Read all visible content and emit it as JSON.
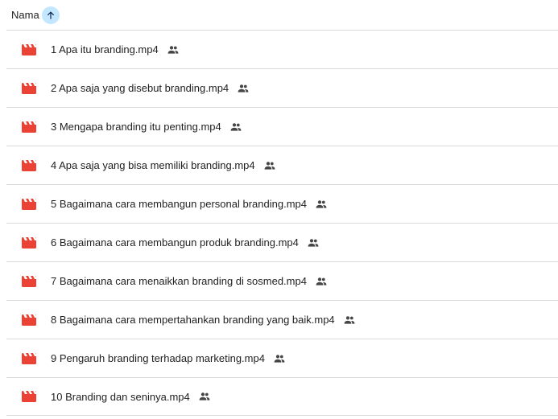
{
  "header": {
    "column_label": "Nama",
    "sort_icon": "arrow-up-icon",
    "sort_color": "#c2e7ff"
  },
  "files": [
    {
      "name": "1 Apa itu branding.mp4",
      "icon": "video-file-icon",
      "shared_icon": "people-icon"
    },
    {
      "name": "2 Apa saja yang disebut branding.mp4",
      "icon": "video-file-icon",
      "shared_icon": "people-icon"
    },
    {
      "name": "3 Mengapa branding itu penting.mp4",
      "icon": "video-file-icon",
      "shared_icon": "people-icon"
    },
    {
      "name": "4 Apa saja yang bisa memiliki branding.mp4",
      "icon": "video-file-icon",
      "shared_icon": "people-icon"
    },
    {
      "name": "5 Bagaimana cara membangun personal branding.mp4",
      "icon": "video-file-icon",
      "shared_icon": "people-icon"
    },
    {
      "name": "6 Bagaimana cara membangun produk branding.mp4",
      "icon": "video-file-icon",
      "shared_icon": "people-icon"
    },
    {
      "name": "7 Bagaimana cara menaikkan branding di sosmed.mp4",
      "icon": "video-file-icon",
      "shared_icon": "people-icon"
    },
    {
      "name": "8 Bagaimana cara mempertahankan branding yang baik.mp4",
      "icon": "video-file-icon",
      "shared_icon": "people-icon"
    },
    {
      "name": "9 Pengaruh branding terhadap marketing.mp4",
      "icon": "video-file-icon",
      "shared_icon": "people-icon"
    },
    {
      "name": "10 Branding dan seninya.mp4",
      "icon": "video-file-icon",
      "shared_icon": "people-icon"
    }
  ],
  "colors": {
    "video_icon": "#ea4335",
    "text": "#1f1f1f",
    "divider": "#dadce0",
    "shared_icon": "#444746"
  }
}
